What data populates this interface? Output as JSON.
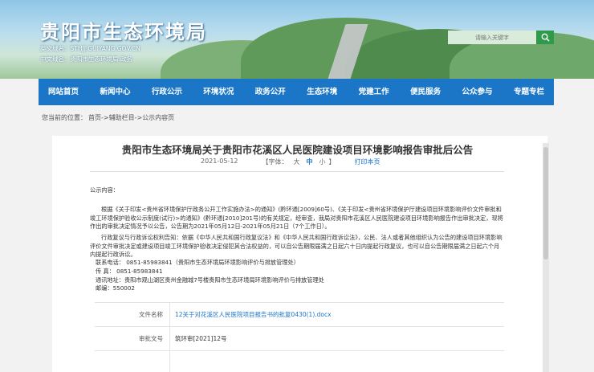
{
  "header": {
    "site_title": "贵阳市生态环境局",
    "domain_en": "英文域名：STHJJ.GUIYANG.GOV.CN",
    "domain_cn": "中文域名：贵阳市生态环境局.政务",
    "search_placeholder": "请输入关键字"
  },
  "nav": {
    "items": [
      "网站首页",
      "新闻中心",
      "行政公示",
      "环境状况",
      "政务公开",
      "生态环境",
      "党建工作",
      "便民服务",
      "公众参与",
      "专题专栏"
    ]
  },
  "breadcrumb": {
    "prefix": "您当前的位置：",
    "path": "首页->辅助栏目->公示内容页"
  },
  "article": {
    "title": "贵阳市生态环境局关于贵阳市花溪区人民医院建设项目环境影响报告审批后公告",
    "date": "2021-05-12",
    "font_size_label": "【字体：",
    "font_large": "大",
    "font_medium": "中",
    "font_small": "小",
    "font_close": "】",
    "print_label": "打印本页",
    "notice_label": "公示内容：",
    "para1": "根据《关于印发<贵州省环境保护厅政务公开工作实施办法>的通知》(黔环通[2009]60号)、《关于印发<贵州省环境保护厅建设项目环境影响评价文件审批和竣工环境保护验收公示制度(试行)>的通知》(黔环通[2010]201号)的有关规定，经审查，我局对贵阳市花溪区人民医院建设项目环境影响报告作出审批决定，现将作出的审批决定情况予以公告，公告期为2021年05月12日-2021年05月21日（7个工作日）。",
    "para2": "行政复议与行政诉讼权利告知：依据《中华人民共和国行政复议法》和《中华人民共和国行政诉讼法》，公民、法人或者其他组织认为公告的建设项目环境影响评价文件审批决定或建设项目竣工环境保护验收决定侵犯其合法权益的，可以自公告期限届满之日起六十日内提起行政复议，也可以自公告期限届满之日起六个月内提起行政诉讼。",
    "contact_phone": "联系电话： 0851-85983841（贵阳市生态环境局环境影响评价与排放管理处）",
    "contact_fax": "传 真： 0851-85983841",
    "contact_address": "通讯地址：贵阳市观山湖区贵州金融城7号楼贵阳市生态环境局环境影响评价与排放管理处",
    "contact_zip": "邮编：550002"
  },
  "info_table": {
    "rows": [
      {
        "label": "文件名称",
        "value": "12关于对花溪区人民医院项目报告书的批复0430(1).docx"
      },
      {
        "label": "审批文号",
        "value": "筑环审[2021]12号"
      },
      {
        "label": "",
        "value": ""
      }
    ]
  },
  "colors": {
    "nav_bg": "#1b76c8",
    "search_btn": "#2f9b4a",
    "link": "#1b76c8"
  }
}
